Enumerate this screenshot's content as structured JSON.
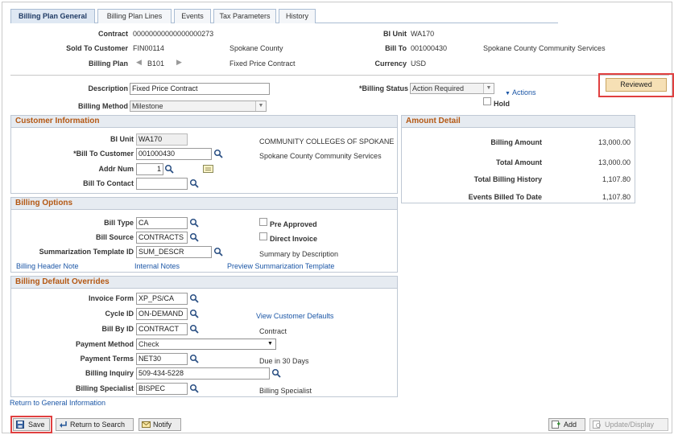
{
  "tabs": [
    {
      "label": "Billing Plan General",
      "active": true
    },
    {
      "label": "Billing Plan Lines",
      "active": false
    },
    {
      "label": "Events",
      "active": false
    },
    {
      "label": "Tax Parameters",
      "active": false
    },
    {
      "label": "History",
      "active": false
    }
  ],
  "header": {
    "contract_label": "Contract",
    "contract_value": "00000000000000000273",
    "bi_unit_label": "BI Unit",
    "bi_unit_value": "WA170",
    "sold_to_label": "Sold To Customer",
    "sold_to_id": "FIN00114",
    "sold_to_name": "Spokane County",
    "bill_to_label": "Bill To",
    "bill_to_id": "001000430",
    "bill_to_name": "Spokane County Community Services",
    "billing_plan_label": "Billing Plan",
    "billing_plan_value": "B101",
    "billing_plan_desc": "Fixed Price Contract",
    "currency_label": "Currency",
    "currency_value": "USD"
  },
  "general": {
    "description_label": "Description",
    "description_value": "Fixed Price Contract",
    "billing_status_label": "*Billing Status",
    "billing_status_value": "Action Required",
    "actions_label": "Actions",
    "reviewed_label": "Reviewed",
    "billing_method_label": "Billing Method",
    "billing_method_value": "Milestone",
    "hold_label": "Hold"
  },
  "customer_info": {
    "title": "Customer Information",
    "bi_unit_label": "BI Unit",
    "bi_unit_value": "WA170",
    "college_name": "COMMUNITY COLLEGES OF SPOKANE",
    "bill_to_customer_label": "*Bill To Customer",
    "bill_to_customer_value": "001000430",
    "bill_to_customer_name": "Spokane County Community Services",
    "addr_num_label": "Addr Num",
    "addr_num_value": "1",
    "bill_to_contact_label": "Bill To Contact",
    "bill_to_contact_value": ""
  },
  "amount_detail": {
    "title": "Amount Detail",
    "rows": [
      {
        "label": "Billing Amount",
        "value": "13,000.00"
      },
      {
        "label": "Total Amount",
        "value": "13,000.00"
      },
      {
        "label": "Total Billing History",
        "value": "1,107.80"
      },
      {
        "label": "Events Billed To Date",
        "value": "1,107.80"
      }
    ]
  },
  "billing_options": {
    "title": "Billing Options",
    "bill_type_label": "Bill Type",
    "bill_type_value": "CA",
    "pre_approved_label": "Pre Approved",
    "bill_source_label": "Bill Source",
    "bill_source_value": "CONTRACTS",
    "direct_invoice_label": "Direct Invoice",
    "summ_template_label": "Summarization Template ID",
    "summ_template_value": "SUM_DESCR",
    "summ_template_desc": "Summary by Description",
    "billing_header_note": "Billing Header Note",
    "internal_notes": "Internal Notes",
    "preview_template": "Preview Summarization Template"
  },
  "overrides": {
    "title": "Billing Default Overrides",
    "invoice_form_label": "Invoice Form",
    "invoice_form_value": "XP_PS/CA",
    "cycle_id_label": "Cycle ID",
    "cycle_id_value": "ON-DEMAND",
    "view_customer_defaults": "View Customer Defaults",
    "bill_by_label": "Bill By ID",
    "bill_by_value": "CONTRACT",
    "bill_by_desc": "Contract",
    "payment_method_label": "Payment Method",
    "payment_method_value": "Check",
    "payment_terms_label": "Payment Terms",
    "payment_terms_value": "NET30",
    "payment_terms_desc": "Due in 30 Days",
    "billing_inquiry_label": "Billing Inquiry",
    "billing_inquiry_value": "509-434-5228",
    "billing_specialist_label": "Billing Specialist",
    "billing_specialist_value": "BISPEC",
    "billing_specialist_desc": "Billing Specialist"
  },
  "footer": {
    "return_link": "Return to General Information",
    "save": "Save",
    "return_to_search": "Return to Search",
    "notify": "Notify",
    "add": "Add",
    "update_display": "Update/Display"
  },
  "colors": {
    "section_title": "#b45813",
    "link": "#1b56a6",
    "highlight": "#e04040"
  }
}
